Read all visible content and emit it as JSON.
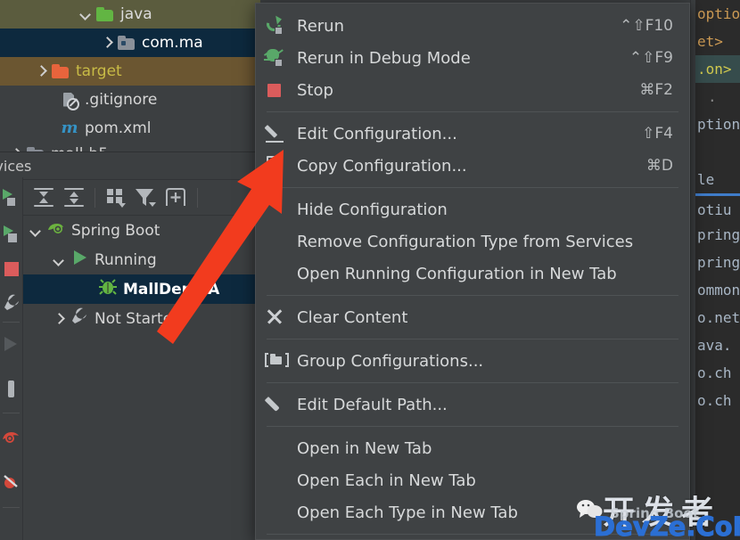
{
  "project_tree": {
    "rows": [
      {
        "label": "java",
        "icon": "folder-green-icon",
        "chevron": "down",
        "indent": 88,
        "highlight": "olive"
      },
      {
        "label": "com.ma",
        "icon": "source-folder-icon",
        "chevron": "right",
        "indent": 112,
        "highlight": "blue"
      },
      {
        "label": "target",
        "icon": "folder-orange-icon",
        "chevron": "right",
        "indent": 38,
        "highlight": "brown"
      },
      {
        "label": ".gitignore",
        "icon": "gitignore-file-icon",
        "chevron": "none",
        "indent": 68,
        "highlight": "none"
      },
      {
        "label": "pom.xml",
        "icon": "maven-file-icon",
        "chevron": "none",
        "indent": 68,
        "highlight": "none"
      },
      {
        "label": "mall-b5",
        "icon": "folder-icon",
        "chevron": "right",
        "indent": 10,
        "highlight": "none"
      }
    ]
  },
  "services": {
    "tab_label": "ervices",
    "toolbar_buttons": [
      "expand-all-icon",
      "collapse-all-icon",
      "group-by-icon",
      "filter-icon",
      "add-tab-icon"
    ],
    "tree": [
      {
        "label": "Spring Boot",
        "chevron": "down",
        "icon": "spring-boot-icon",
        "indent": 6,
        "selected": false
      },
      {
        "label": "Running",
        "chevron": "down",
        "icon": "run-play-icon",
        "indent": 32,
        "selected": false
      },
      {
        "label": "MallDemoA",
        "chevron": "none",
        "icon": "spring-bug-icon",
        "indent": 84,
        "selected": true
      },
      {
        "label": "Not Started",
        "chevron": "right",
        "icon": "wrench-icon",
        "indent": 32,
        "selected": false
      }
    ]
  },
  "left_strip": {
    "icons": [
      "run-icon",
      "debug-icon",
      "stop-icon",
      "wrench-icon",
      "collapse-arrow-icon",
      "pin-icon",
      "spring-icon",
      "spring-run-icon"
    ]
  },
  "editor": {
    "lines": [
      {
        "text": "optio",
        "color": "#cc9a54"
      },
      {
        "text": "et>",
        "color": "#cc9a54"
      },
      {
        "text": ".on>",
        "color": "#d0c94e",
        "highlight": "#364c4c"
      },
      {
        "text": ".",
        "color": "#8a8a8a"
      },
      {
        "text": "ption",
        "color": "#a9b7c6"
      },
      {
        "text": "",
        "color": "#a9b7c6"
      },
      {
        "text": "le",
        "color": "#a9b7c6"
      },
      {
        "text": "otiu",
        "color": "#a9b7c6",
        "underline": "#3f7cc9"
      },
      {
        "text": "pring",
        "color": "#a9b7c6"
      },
      {
        "text": "pring",
        "color": "#a9b7c6"
      },
      {
        "text": "ommon",
        "color": "#a9b7c6"
      },
      {
        "text": "o.net",
        "color": "#a9b7c6"
      },
      {
        "text": "ava.",
        "color": "#a9b7c6"
      },
      {
        "text": "o.ch",
        "color": "#a9b7c6"
      },
      {
        "text": "o.ch",
        "color": "#a9b7c6"
      }
    ]
  },
  "context_menu": {
    "items": [
      {
        "type": "item",
        "label": "Rerun",
        "shortcut": "⌃⇧F10",
        "icon": "rerun-icon"
      },
      {
        "type": "item",
        "label": "Rerun in Debug Mode",
        "shortcut": "⌃⇧F9",
        "icon": "rerun-debug-icon"
      },
      {
        "type": "item",
        "label": "Stop",
        "shortcut": "⌘F2",
        "icon": "stop-icon"
      },
      {
        "type": "separator"
      },
      {
        "type": "item",
        "label": "Edit Configuration...",
        "shortcut": "⇧F4",
        "icon": "edit-pencil-icon"
      },
      {
        "type": "item",
        "label": "Copy Configuration...",
        "shortcut": "⌘D",
        "icon": "copy-icon"
      },
      {
        "type": "separator"
      },
      {
        "type": "item",
        "label": "Hide Configuration",
        "shortcut": "",
        "icon": "none"
      },
      {
        "type": "item",
        "label": "Remove Configuration Type from Services",
        "shortcut": "",
        "icon": "none"
      },
      {
        "type": "item",
        "label": "Open Running Configuration in New Tab",
        "shortcut": "",
        "icon": "none"
      },
      {
        "type": "separator"
      },
      {
        "type": "item",
        "label": "Clear Content",
        "shortcut": "",
        "icon": "clear-x-icon"
      },
      {
        "type": "separator"
      },
      {
        "type": "item",
        "label": "Group Configurations...",
        "shortcut": "",
        "icon": "group-folder-icon"
      },
      {
        "type": "separator"
      },
      {
        "type": "item",
        "label": "Edit Default Path...",
        "shortcut": "",
        "icon": "edit-pencil-icon"
      },
      {
        "type": "separator"
      },
      {
        "type": "item",
        "label": "Open in New Tab",
        "shortcut": "",
        "icon": "none"
      },
      {
        "type": "item",
        "label": "Open Each in New Tab",
        "shortcut": "",
        "icon": "none"
      },
      {
        "type": "item",
        "label": "Open Each Type in New Tab",
        "shortcut": "",
        "icon": "none"
      },
      {
        "type": "separator"
      }
    ]
  },
  "annotation": {
    "arrow_color": "#f23b1e",
    "arrow_description": "red-arrow-pointing-to-copy-configuration"
  },
  "watermark": {
    "cn_text": "开发者",
    "site_text": "DevZe.CoM",
    "spring_text": "Spring Boot",
    "wechat_icon": "wechat-icon"
  },
  "colors": {
    "menu_bg": "#3f4244",
    "ide_bg": "#3c3f41",
    "editor_bg": "#2b2b2b",
    "selection_blue": "#0d293e",
    "accent_green": "#59a869",
    "accent_red": "#db5c5c",
    "arrow_red": "#f23b1e",
    "link_blue": "#2b6fd4"
  }
}
